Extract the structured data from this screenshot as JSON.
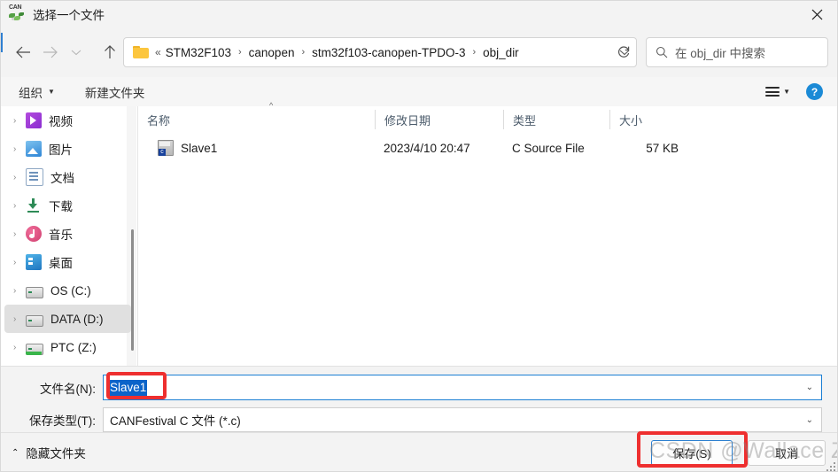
{
  "window": {
    "title": "选择一个文件",
    "icon": "canfestival-icon",
    "close_label": "✕"
  },
  "nav": {
    "back": "back-arrow",
    "forward": "forward-arrow",
    "recent": "recent-chevron",
    "up": "up-arrow",
    "refresh": "refresh-icon"
  },
  "breadcrumb": {
    "folder_icon": "folder-icon",
    "overflow": "«",
    "separator": "›",
    "segments": [
      "STM32F103",
      "canopen",
      "stm32f103-canopen-TPDO-3",
      "obj_dir"
    ],
    "dropdown": "⌄"
  },
  "search": {
    "icon": "search-icon",
    "placeholder": "在 obj_dir 中搜索"
  },
  "commandbar": {
    "organize": "组织",
    "organize_caret": "▼",
    "new_folder": "新建文件夹",
    "view_icon": "list-view-icon",
    "view_caret": "▼",
    "help": "?"
  },
  "sidebar": {
    "items": [
      {
        "label": "视频",
        "icon": "video-icon",
        "expander": "›",
        "selected": false
      },
      {
        "label": "图片",
        "icon": "pictures-icon",
        "expander": "›",
        "selected": false
      },
      {
        "label": "文档",
        "icon": "documents-icon",
        "expander": "›",
        "selected": false
      },
      {
        "label": "下载",
        "icon": "downloads-icon",
        "expander": "›",
        "selected": false
      },
      {
        "label": "音乐",
        "icon": "music-icon",
        "expander": "›",
        "selected": false
      },
      {
        "label": "桌面",
        "icon": "desktop-icon",
        "expander": "›",
        "selected": false
      },
      {
        "label": "OS (C:)",
        "icon": "drive-icon",
        "expander": "›",
        "selected": false
      },
      {
        "label": "DATA (D:)",
        "icon": "drive-icon",
        "expander": "›",
        "selected": true
      },
      {
        "label": "PTC (Z:)",
        "icon": "network-drive-icon",
        "expander": "›",
        "selected": false
      }
    ]
  },
  "filelist": {
    "columns": {
      "name": "名称",
      "date": "修改日期",
      "type": "类型",
      "size": "大小",
      "sort_indicator": "^"
    },
    "rows": [
      {
        "name": "Slave1",
        "date": "2023/4/10 20:47",
        "type": "C Source File",
        "size": "57 KB",
        "icon": "c-source-file-icon"
      }
    ]
  },
  "form": {
    "filename_label": "文件名(N):",
    "filename_value": "Slave1",
    "filetype_label": "保存类型(T):",
    "filetype_value": "CANFestival C 文件 (*.c)",
    "combo_caret": "⌄"
  },
  "footer": {
    "hide_folders_chevron": "⌃",
    "hide_folders_label": "隐藏文件夹",
    "save_label": "保存(S)",
    "cancel_label": "取消"
  },
  "watermark": {
    "text": "CSDN @Wallace Zhang"
  },
  "colors": {
    "accent": "#0b63c9",
    "annotation": "#ee2f2f",
    "primary_button_border": "#2b7fd0",
    "help_blue": "#1b8ad6",
    "folder_yellow": "#fcc63e"
  }
}
